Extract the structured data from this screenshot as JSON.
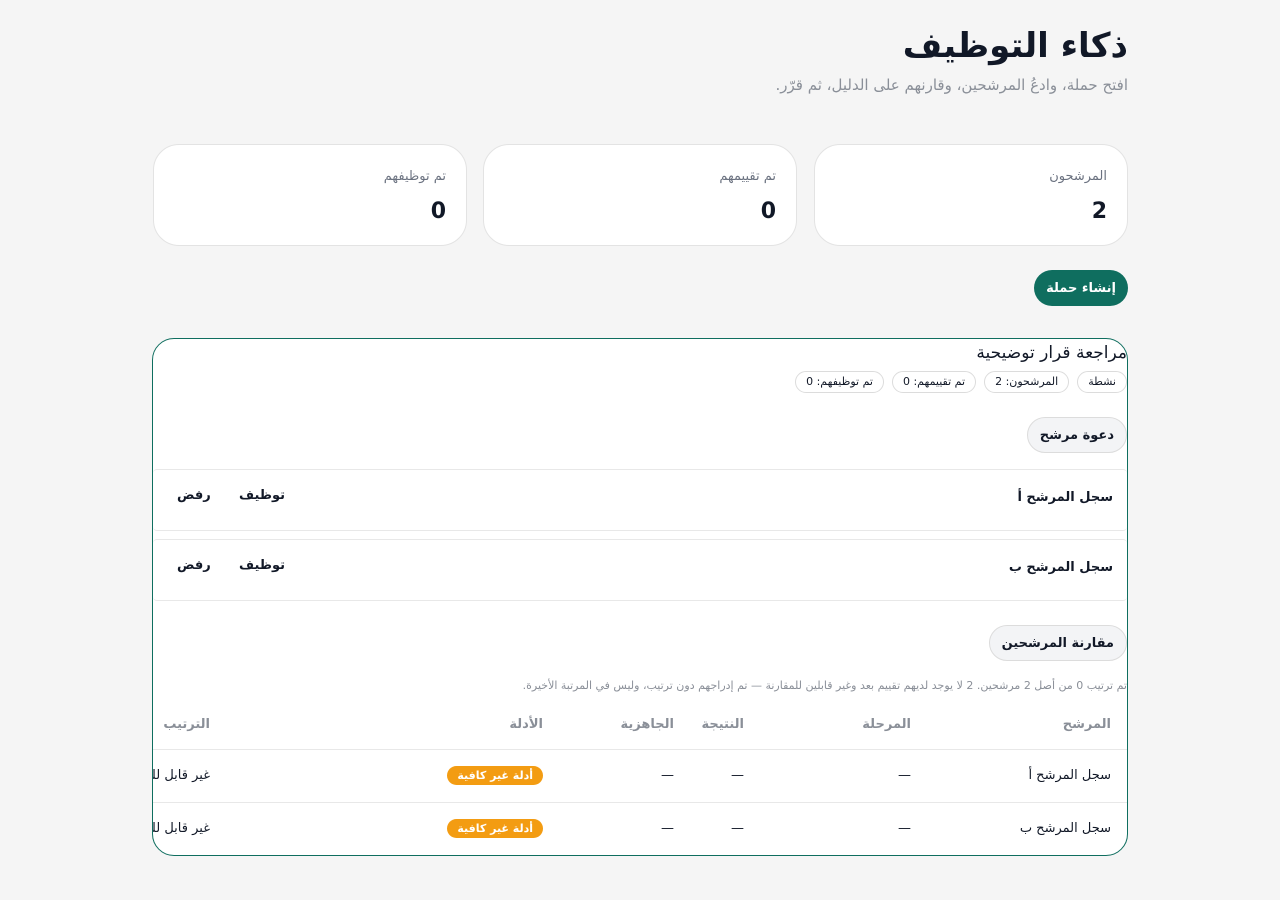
{
  "header": {
    "title": "ذكاء التوظيف",
    "subtitle": "افتح حملة، وادعُ المرشحين، وقارنهم على الدليل، ثم قرّر."
  },
  "stats": [
    {
      "label": "المرشحون",
      "value": "2"
    },
    {
      "label": "تم تقييمهم",
      "value": "0"
    },
    {
      "label": "تم توظيفهم",
      "value": "0"
    }
  ],
  "create_campaign_label": "إنشاء حملة",
  "campaign": {
    "title": "مراجعة قرار توضيحية",
    "chips": [
      "نشطة",
      "المرشحون: 2",
      "تم تقييمهم: 0",
      "تم توظيفهم: 0"
    ],
    "invite_label": "دعوة مرشح",
    "candidates": [
      {
        "name": "سجل المرشح أ",
        "hire_label": "توظيف",
        "reject_label": "رفض"
      },
      {
        "name": "سجل المرشح ب",
        "hire_label": "توظيف",
        "reject_label": "رفض"
      }
    ],
    "compare_label": "مقارنة المرشحين",
    "note": "تم ترتيب 0 من أصل 2 مرشحين. 2 لا يوجد لديهم تقييم بعد وغير قابلين للمقارنة — تم إدراجهم دون ترتيب، وليس في المرتبة الأخيرة.",
    "table": {
      "headers": [
        "المرشح",
        "المرحلة",
        "النتيجة",
        "الجاهزية",
        "الأدلة",
        "الترتيب"
      ],
      "rows": [
        {
          "candidate": "سجل المرشح أ",
          "stage": "—",
          "result": "—",
          "readiness": "—",
          "evidence": "أدلة غير كافية",
          "rank": "غير قابل للمقارنة"
        },
        {
          "candidate": "سجل المرشح ب",
          "stage": "—",
          "result": "—",
          "readiness": "—",
          "evidence": "أدلة غير كافية",
          "rank": "غير قابل للمقارنة"
        }
      ]
    }
  },
  "colors": {
    "accent": "#0f6e5f",
    "warning_badge": "#f39c12",
    "background": "#f5f5f5"
  }
}
